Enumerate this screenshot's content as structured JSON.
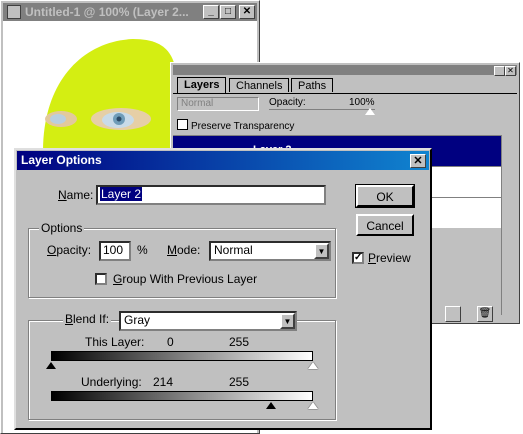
{
  "document_window": {
    "title": "Untitled-1 @ 100% (Layer 2...",
    "buttons": {
      "minimize": "_",
      "maximize": "□",
      "close": "✕"
    }
  },
  "layers_palette": {
    "tabs": [
      "Layers",
      "Channels",
      "Paths"
    ],
    "blend_mode": "Normal",
    "opacity_label": "Opacity:",
    "opacity_value": "100%",
    "preserve_transparency": "Preserve Transparency",
    "layer_name": "Layer 2"
  },
  "dialog": {
    "title": "Layer Options",
    "name_label": "Name:",
    "name_value": "Layer 2",
    "ok_label": "OK",
    "cancel_label": "Cancel",
    "preview_label": "Preview",
    "preview_checked": true,
    "options_group": "Options",
    "opacity_label": "Opacity:",
    "opacity_value": "100",
    "opacity_unit": "%",
    "mode_label": "Mode:",
    "mode_value": "Normal",
    "group_with_previous": "Group With Previous Layer",
    "group_checked": false,
    "blend_if_label": "Blend If:",
    "blend_if_value": "Gray",
    "this_layer_label": "This Layer:",
    "this_layer_low": "0",
    "this_layer_high": "255",
    "underlying_label": "Underlying:",
    "underlying_low": "214",
    "underlying_high": "255"
  },
  "colors": {
    "canvas_shape": "#d4ee12",
    "dialog_title": "#000080",
    "selected_layer": "#000080"
  }
}
